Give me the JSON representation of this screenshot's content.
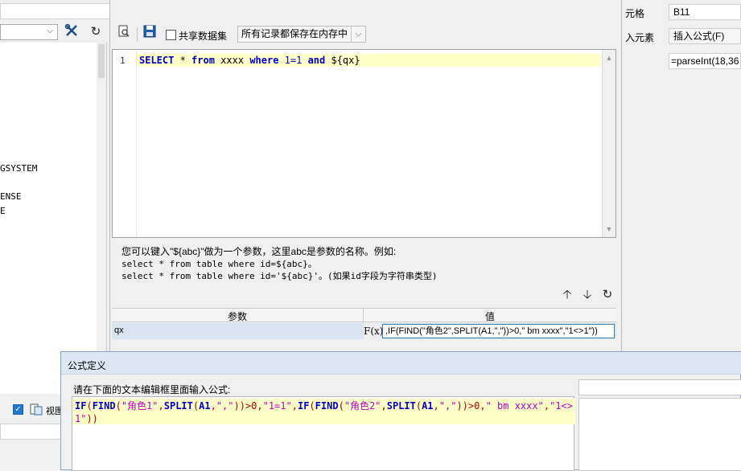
{
  "left_panel": {
    "tree_items": [
      "GSYSTEM",
      "ENSE",
      "E"
    ],
    "view_label": "视图"
  },
  "dataset": {
    "share_label": "共享数据集",
    "memory_option": "所有记录都保存在内存中",
    "sql_line_number": "1",
    "sql": {
      "select": "SELECT",
      "star": " * ",
      "from": "from",
      "table": " xxxx ",
      "where": "where",
      "cond_num": " 1=1 ",
      "and": "and",
      "param": " ${qx}"
    },
    "help_line_1": "您可以键入\"${abc}\"做为一个参数，这里abc是参数的名称。例如:",
    "help_line_2": "select * from table where id=${abc}。",
    "help_line_3": "select * from table where id='${abc}'。(如果id字段为字符串类型)",
    "param_header_name": "参数",
    "param_header_value": "值",
    "param_name": "qx",
    "fx_label": "F(x)",
    "param_value": ",IF(FIND(\"角色2\",SPLIT(A1,\",\"))>0,\" bm xxxx\",\"1<>1\"))"
  },
  "right_panel": {
    "cell_label": "元格",
    "cell_value": "B11",
    "insert_label": "入元素",
    "insert_value": "插入公式(F)",
    "formula_preview": "=parseInt(18,36"
  },
  "formula_dialog": {
    "title": "公式定义",
    "instruction": "请在下面的文本编辑框里面输入公式:",
    "tokens": [
      {
        "t": "IF",
        "c": "fn"
      },
      {
        "t": "(",
        "c": "op"
      },
      {
        "t": "FIND",
        "c": "fn"
      },
      {
        "t": "(",
        "c": "op"
      },
      {
        "t": "\"角色1\"",
        "c": "str"
      },
      {
        "t": ",",
        "c": "op"
      },
      {
        "t": "SPLIT",
        "c": "fn"
      },
      {
        "t": "(",
        "c": "op"
      },
      {
        "t": "A1",
        "c": "fn"
      },
      {
        "t": ",",
        "c": "op"
      },
      {
        "t": "\",\"",
        "c": "str"
      },
      {
        "t": "))>0,",
        "c": "op"
      },
      {
        "t": "\"1=1\"",
        "c": "str"
      },
      {
        "t": ",",
        "c": "op"
      },
      {
        "t": "IF",
        "c": "fn"
      },
      {
        "t": "(",
        "c": "op"
      },
      {
        "t": "FIND",
        "c": "fn"
      },
      {
        "t": "(",
        "c": "op"
      },
      {
        "t": "\"角色2\"",
        "c": "str"
      },
      {
        "t": ",",
        "c": "op"
      },
      {
        "t": "SPLIT",
        "c": "fn"
      },
      {
        "t": "(",
        "c": "op"
      },
      {
        "t": "A1",
        "c": "fn"
      },
      {
        "t": ",",
        "c": "op"
      },
      {
        "t": "\",\"",
        "c": "str"
      },
      {
        "t": "))>0,",
        "c": "op"
      },
      {
        "t": "\" bm xxxx\"",
        "c": "str"
      },
      {
        "t": ",",
        "c": "op"
      },
      {
        "t": "\"1<>1\"",
        "c": "str"
      },
      {
        "t": "))",
        "c": "op"
      }
    ]
  },
  "icons": {
    "tools": "wrench-icon",
    "refresh": "refresh-icon",
    "preview": "preview-icon",
    "save": "save-icon",
    "up": "arrow-up-icon",
    "down": "arrow-down-icon"
  },
  "colors": {
    "keyword": "#0000c8",
    "string": "#c000c0",
    "operator": "#c00000",
    "current_line": "#ffffc8",
    "selected_row": "#dbe5f1"
  }
}
